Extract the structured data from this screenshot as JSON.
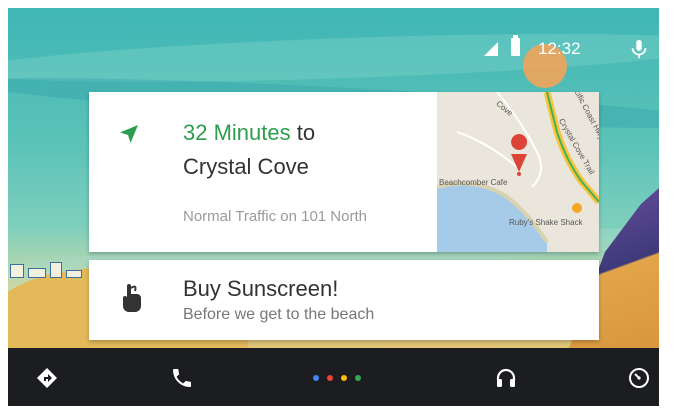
{
  "status_bar": {
    "time": "12:32"
  },
  "navigation_card": {
    "eta_minutes": "32 Minutes",
    "eta_connector": " to",
    "destination": "Crystal Cove",
    "traffic": "Normal Traffic on 101 North",
    "map": {
      "label_cafe": "Beachcomber Cafe",
      "label_shack": "Ruby's Shake Shack",
      "label_cove": "Cove",
      "label_trail": "Crystal Cove Trail",
      "label_highway": "Pacific Coast Hwy"
    }
  },
  "reminder_card": {
    "title": "Buy Sunscreen!",
    "subtitle": "Before we get to the beach"
  },
  "bottom_nav": {
    "items": [
      "navigation-icon",
      "phone-icon",
      "home-dots",
      "headphones-icon",
      "speedometer-icon"
    ],
    "dot_colors": [
      "#4285f4",
      "#ea4335",
      "#fbbc05",
      "#34a853"
    ]
  },
  "colors": {
    "accent_green": "#2e9d4f",
    "navbar_bg": "#1c1d20",
    "pin_red": "#db4437"
  }
}
